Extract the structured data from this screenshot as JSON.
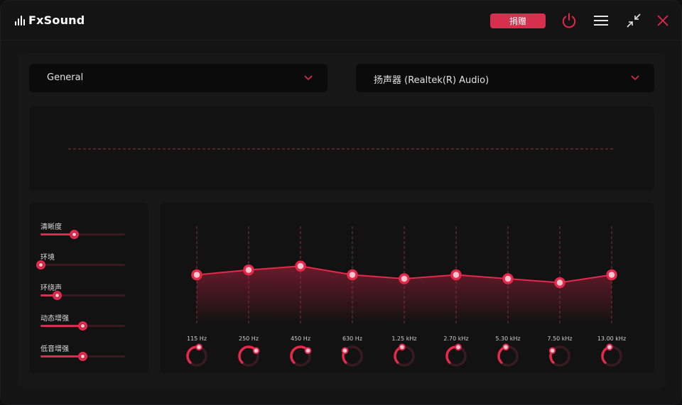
{
  "app": {
    "name": "FxSound"
  },
  "header": {
    "donate_label": "捐赠",
    "icons": [
      "power-icon",
      "menu-icon",
      "minimize-icon",
      "close-icon"
    ]
  },
  "preset": {
    "value": "General"
  },
  "output": {
    "value": "扬声器 (Realtek(R) Audio)"
  },
  "effects": [
    {
      "label": "清晰度",
      "level": 0.4
    },
    {
      "label": "环境",
      "level": 0.0
    },
    {
      "label": "环绕声",
      "level": 0.2
    },
    {
      "label": "动态增强",
      "level": 0.5
    },
    {
      "label": "低音增强",
      "level": 0.5
    }
  ],
  "eq": {
    "bands": [
      {
        "freq": "115 Hz",
        "gain": 0.5,
        "knob": 0.55
      },
      {
        "freq": "250 Hz",
        "gain": 0.55,
        "knob": 0.7
      },
      {
        "freq": "450 Hz",
        "gain": 0.59,
        "knob": 0.7
      },
      {
        "freq": "630 Hz",
        "gain": 0.5,
        "knob": 0.3
      },
      {
        "freq": "1.25 kHz",
        "gain": 0.46,
        "knob": 0.45
      },
      {
        "freq": "2.70 kHz",
        "gain": 0.5,
        "knob": 0.55
      },
      {
        "freq": "5.30 kHz",
        "gain": 0.46,
        "knob": 0.45
      },
      {
        "freq": "7.50 kHz",
        "gain": 0.42,
        "knob": 0.3
      },
      {
        "freq": "13.00 kHz",
        "gain": 0.5,
        "knob": 0.45
      }
    ]
  },
  "colors": {
    "accent": "#e6284b",
    "accent_dark": "#3a1a22",
    "background": "#141415"
  }
}
